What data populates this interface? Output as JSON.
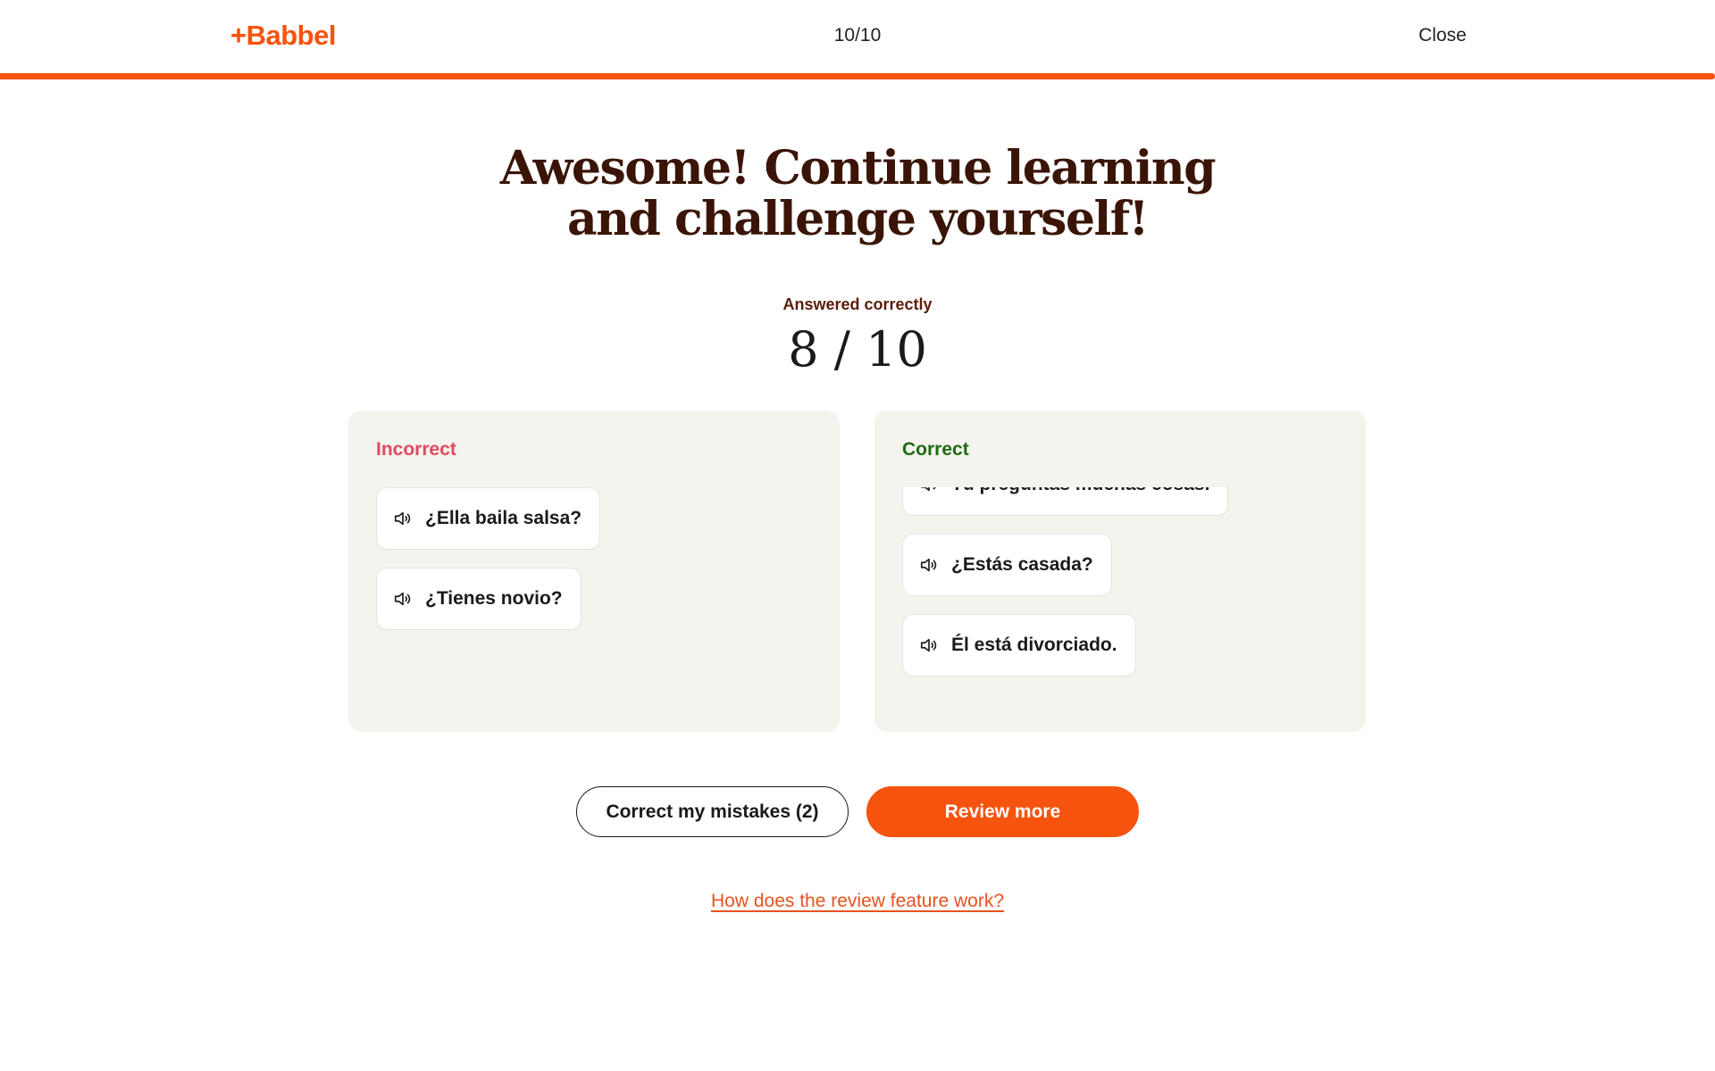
{
  "header": {
    "logo_text": "+Babbel",
    "progress_text": "10/10",
    "progress_fraction": 1.0,
    "close_label": "Close",
    "accent_color": "#f5530e"
  },
  "result": {
    "headline_line1": "Awesome! Continue learning",
    "headline_line2": "and challenge yourself!",
    "score_label": "Answered correctly",
    "score_value": "8 / 10"
  },
  "incorrect_panel": {
    "title": "Incorrect",
    "title_color": "#e04a5e",
    "items": [
      {
        "text": "¿Ella baila salsa?",
        "icon": "speaker-icon"
      },
      {
        "text": "¿Tienes novio?",
        "icon": "speaker-icon"
      }
    ]
  },
  "correct_panel": {
    "title": "Correct",
    "title_color": "#1f6a14",
    "items": [
      {
        "text": "Tú preguntas muchas cosas.",
        "icon": "speaker-icon"
      },
      {
        "text": "¿Estás casada?",
        "icon": "speaker-icon"
      },
      {
        "text": "Él está divorciado.",
        "icon": "speaker-icon"
      }
    ]
  },
  "actions": {
    "correct_mistakes_label": "Correct my mistakes (2)",
    "review_more_label": "Review more",
    "help_link_label": "How does the review feature work?"
  }
}
